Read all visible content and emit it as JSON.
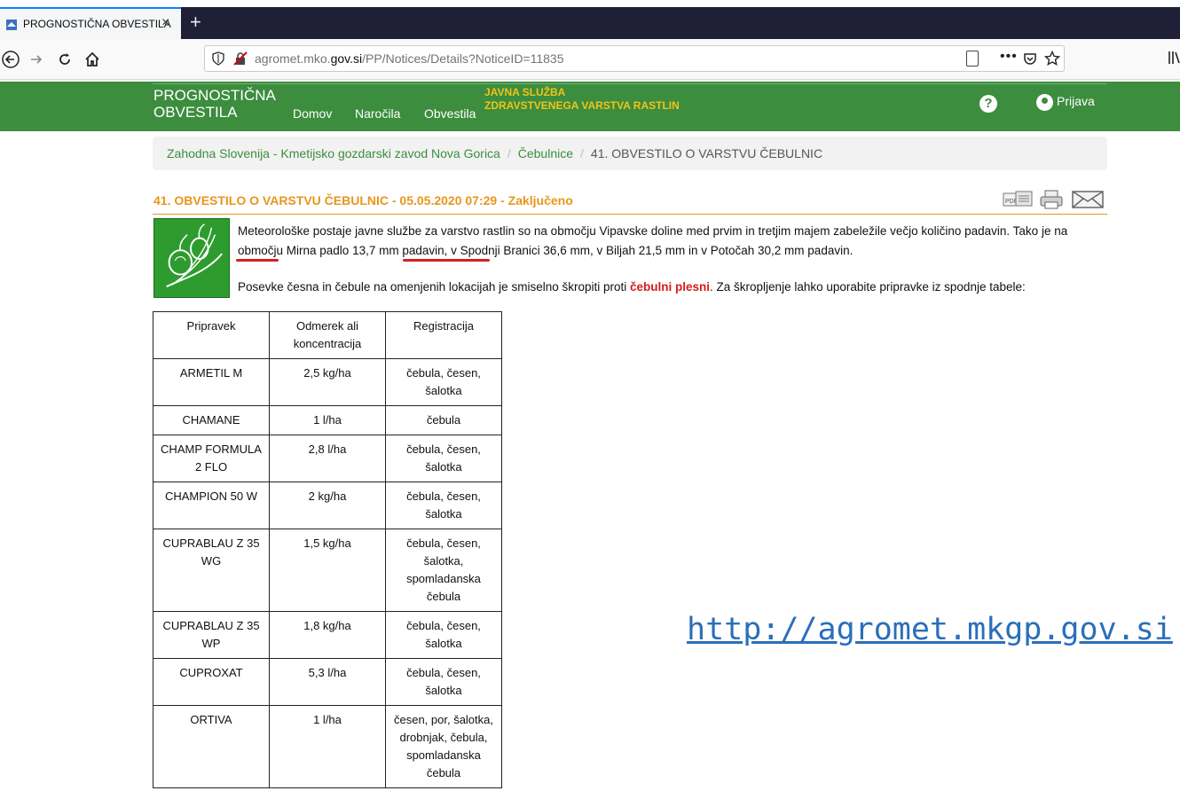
{
  "browser": {
    "tab_title": "PROGNOSTIČNA OBVESTILA",
    "tab_close": "×",
    "new_tab": "+",
    "url_domain_prefix": "agromet.mko.",
    "url_domain_bold": "gov.si",
    "url_path": "/PP/Notices/Details?NoticeID=11835",
    "menu_dots": "•••"
  },
  "header": {
    "brand_line1": "PROGNOSTIČNA",
    "brand_line2": "OBVESTILA",
    "nav": [
      "Domov",
      "Naročila",
      "Obvestila"
    ],
    "service_line1": "JAVNA SLUŽBA",
    "service_line2": "ZDRAVSTVENEGA VARSTVA RASTLIN",
    "help": "?",
    "login": "Prijava"
  },
  "breadcrumb": {
    "items": [
      "Zahodna Slovenija - Kmetijsko gozdarski zavod Nova Gorica",
      "Čebulnice"
    ],
    "separator": "/",
    "current": "41. OBVESTILO O VARSTVU ČEBULNIC"
  },
  "notice": {
    "title": "41. OBVESTILO O VARSTVU ČEBULNIC - 05.05.2020 07:29 - Zaključeno",
    "paragraph1_a": "Meteorološke postaje javne službe za varstvo rastlin so na območju Vipavske doline med prvim in tretjim majem zabeležile večjo količino padavin. Tako je na območju Mirna padlo 13,7 mm padavin, v Spodnji Branici 36,6 mm, v Biljah 21,5 mm in v Potočah 30,2 mm padavin.",
    "paragraph2_a": "Posevke česna in čebule na omenjenih lokacijah je smiselno škropiti proti ",
    "paragraph2_highlight": "čebulni plesni",
    "paragraph2_b": ". Za škropljenje lahko uporabite pripravke iz spodnje tabele:"
  },
  "table": {
    "headers": [
      "Pripravek",
      "Odmerek ali koncentracija",
      "Registracija"
    ],
    "rows": [
      [
        "ARMETIL M",
        "2,5 kg/ha",
        "čebula, česen, šalotka"
      ],
      [
        "CHAMANE",
        "1 l/ha",
        "čebula"
      ],
      [
        "CHAMP FORMULA 2 FLO",
        "2,8 l/ha",
        "čebula, česen, šalotka"
      ],
      [
        "CHAMPION 50 W",
        "2 kg/ha",
        "čebula, česen, šalotka"
      ],
      [
        "CUPRABLAU Z 35 WG",
        "1,5 kg/ha",
        "čebula, česen, šalotka, spomladanska čebula"
      ],
      [
        "CUPRABLAU Z 35 WP",
        "1,8 kg/ha",
        "čebula, česen, šalotka"
      ],
      [
        "CUPROXAT",
        "5,3 l/ha",
        "čebula, česen, šalotka"
      ],
      [
        "ORTIVA",
        "1 l/ha",
        "česen, por, šalotka, drobnjak, čebula, spomladanska čebula"
      ]
    ]
  },
  "overlay_link": "http://agromet.mkgp.gov.si",
  "colors": {
    "header_green": "#3c8d3e",
    "title_orange": "#e8961c",
    "highlight_red": "#d61a1a",
    "link_blue": "#2a6fba"
  }
}
